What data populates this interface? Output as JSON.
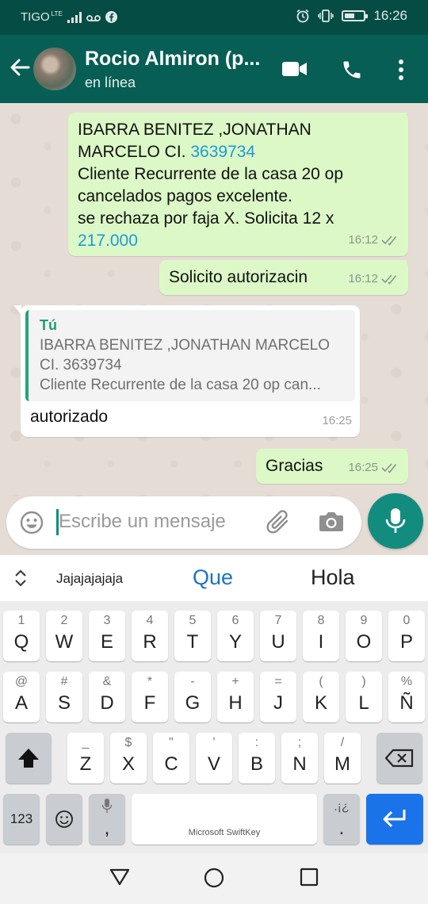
{
  "status_bar": {
    "carrier": "TIGO",
    "network_badge": "LTE",
    "time": "16:26",
    "icons": [
      "signal-icon",
      "voicemail-icon",
      "facebook-icon",
      "alarm-icon",
      "vibrate-icon",
      "battery-icon"
    ]
  },
  "header": {
    "contact_name": "Rocio Almiron (p...",
    "status": "en línea",
    "icons": [
      "back-arrow-icon",
      "video-call-icon",
      "phone-icon",
      "more-options-icon"
    ]
  },
  "messages": [
    {
      "direction": "outgoing",
      "lines": [
        "IBARRA BENITEZ ,JONATHAN",
        "MARCELO  CI. ",
        "3639734",
        "Cliente Recurrente de la casa 20 op",
        "cancelados pagos excelente.",
        "se rechaza por faja X. Solicita 12 x",
        "217.000"
      ],
      "time": "16:12",
      "status_icon": "double-check-icon"
    },
    {
      "direction": "outgoing",
      "text": "Solicito autorizacin",
      "time": "16:12",
      "status_icon": "double-check-icon"
    },
    {
      "direction": "incoming",
      "quote": {
        "author": "Tú",
        "lines": [
          "IBARRA BENITEZ ,JONATHAN MARCELO",
          "CI. 3639734",
          "Cliente Recurrente de la casa 20 op can..."
        ]
      },
      "text": "autorizado",
      "time": "16:25"
    },
    {
      "direction": "outgoing",
      "text": "Gracias",
      "time": "16:25",
      "status_icon": "double-check-icon"
    }
  ],
  "composer": {
    "placeholder": "Escribe un mensaje",
    "icons": [
      "emoji-icon",
      "attach-icon",
      "camera-icon",
      "mic-icon"
    ]
  },
  "keyboard": {
    "suggestions": [
      "Jajajajajaja",
      "Que",
      "Hola"
    ],
    "row1": [
      [
        "1",
        "Q"
      ],
      [
        "2",
        "W"
      ],
      [
        "3",
        "E"
      ],
      [
        "4",
        "R"
      ],
      [
        "5",
        "T"
      ],
      [
        "6",
        "Y"
      ],
      [
        "7",
        "U"
      ],
      [
        "8",
        "I"
      ],
      [
        "9",
        "O"
      ],
      [
        "0",
        "P"
      ]
    ],
    "row2": [
      [
        "@",
        "A"
      ],
      [
        "#",
        "S"
      ],
      [
        "&",
        "D"
      ],
      [
        "*",
        "F"
      ],
      [
        "-",
        "G"
      ],
      [
        "+",
        "H"
      ],
      [
        "=",
        "J"
      ],
      [
        "(",
        "K"
      ],
      [
        ")",
        "L"
      ],
      [
        "%",
        "Ñ"
      ]
    ],
    "row3": [
      [
        "_",
        "Z"
      ],
      [
        "$",
        "X"
      ],
      [
        "\"",
        "C"
      ],
      [
        "'",
        "V"
      ],
      [
        ":",
        "B"
      ],
      [
        ";",
        "N"
      ],
      [
        "/",
        "M"
      ]
    ],
    "numbers_key": "123",
    "comma_key": ",",
    "period_key": ".",
    "period_alt": ".¡¿",
    "space_brand": "Microsoft SwiftKey",
    "icons": [
      "shift-icon",
      "backspace-icon",
      "emoji-key-icon",
      "mic-key-icon",
      "enter-icon"
    ]
  },
  "nav_bar": {
    "icons": [
      "back-triangle-icon",
      "home-circle-icon",
      "recents-square-icon"
    ]
  }
}
